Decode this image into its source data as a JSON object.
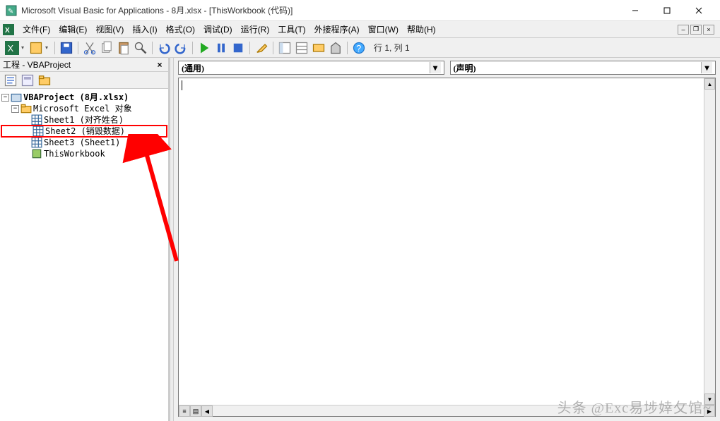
{
  "titlebar": {
    "title": "Microsoft Visual Basic for Applications - 8月.xlsx - [ThisWorkbook (代码)]"
  },
  "menu": {
    "file": "文件(F)",
    "edit": "编辑(E)",
    "view": "视图(V)",
    "insert": "插入(I)",
    "format": "格式(O)",
    "debug": "调试(D)",
    "run": "运行(R)",
    "tools": "工具(T)",
    "addins": "外接程序(A)",
    "window": "窗口(W)",
    "help": "帮助(H)"
  },
  "toolbar": {
    "cursor_status": "行 1, 列 1"
  },
  "project_pane": {
    "title": "工程 - VBAProject",
    "root": "VBAProject (8月.xlsx)",
    "folder": "Microsoft Excel 对象",
    "sheet1": "Sheet1 (对齐姓名)",
    "sheet2": "Sheet2 (销毁数据)",
    "sheet3": "Sheet3 (Sheet1)",
    "thiswb": "ThisWorkbook"
  },
  "code": {
    "object_combo": "(通用)",
    "proc_combo": "(声明)"
  },
  "watermark": "头条 @Exc易埗婞攵馆~"
}
